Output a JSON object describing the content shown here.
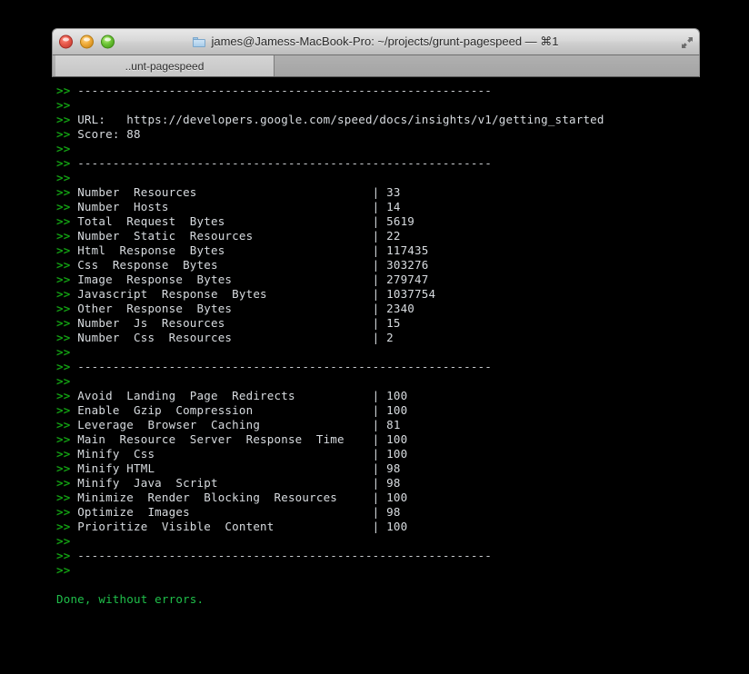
{
  "window": {
    "title": "james@Jamess-MacBook-Pro: ~/projects/grunt-pagespeed — ⌘1",
    "folder_icon": "folder-icon",
    "fullscreen_icon": "fullscreen-arrows-icon",
    "controls": {
      "close": "close-button",
      "minimize": "minimize-button",
      "zoom": "zoom-button"
    }
  },
  "tabs": [
    {
      "label": "..unt-pagespeed",
      "active": true
    }
  ],
  "colors": {
    "prompt_green": "#13a013",
    "text_white": "#d8dce0",
    "done_green": "#1fbf4a",
    "terminal_bg": "#000000"
  },
  "terminal": {
    "prompt": ">>",
    "separator": "-----------------------------------------------------------",
    "summary": {
      "url_label": "URL:",
      "url_value": "https://developers.google.com/speed/docs/insights/v1/getting_started",
      "score_label": "Score:",
      "score_value": "88"
    },
    "stats": [
      {
        "label": "Number  Resources",
        "value": "33"
      },
      {
        "label": "Number  Hosts",
        "value": "14"
      },
      {
        "label": "Total  Request  Bytes",
        "value": "5619"
      },
      {
        "label": "Number  Static  Resources",
        "value": "22"
      },
      {
        "label": "Html  Response  Bytes",
        "value": "117435"
      },
      {
        "label": "Css  Response  Bytes",
        "value": "303276"
      },
      {
        "label": "Image  Response  Bytes",
        "value": "279747"
      },
      {
        "label": "Javascript  Response  Bytes",
        "value": "1037754"
      },
      {
        "label": "Other  Response  Bytes",
        "value": "2340"
      },
      {
        "label": "Number  Js  Resources",
        "value": "15"
      },
      {
        "label": "Number  Css  Resources",
        "value": "2"
      }
    ],
    "rules": [
      {
        "label": "Avoid  Landing  Page  Redirects",
        "value": "100"
      },
      {
        "label": "Enable  Gzip  Compression",
        "value": "100"
      },
      {
        "label": "Leverage  Browser  Caching",
        "value": "81"
      },
      {
        "label": "Main  Resource  Server  Response  Time",
        "value": "100"
      },
      {
        "label": "Minify  Css",
        "value": "100"
      },
      {
        "label": "Minify HTML",
        "value": "98"
      },
      {
        "label": "Minify  Java  Script",
        "value": "98"
      },
      {
        "label": "Minimize  Render  Blocking  Resources",
        "value": "100"
      },
      {
        "label": "Optimize  Images",
        "value": "98"
      },
      {
        "label": "Prioritize  Visible  Content",
        "value": "100"
      }
    ],
    "done_message": "Done, without errors."
  }
}
